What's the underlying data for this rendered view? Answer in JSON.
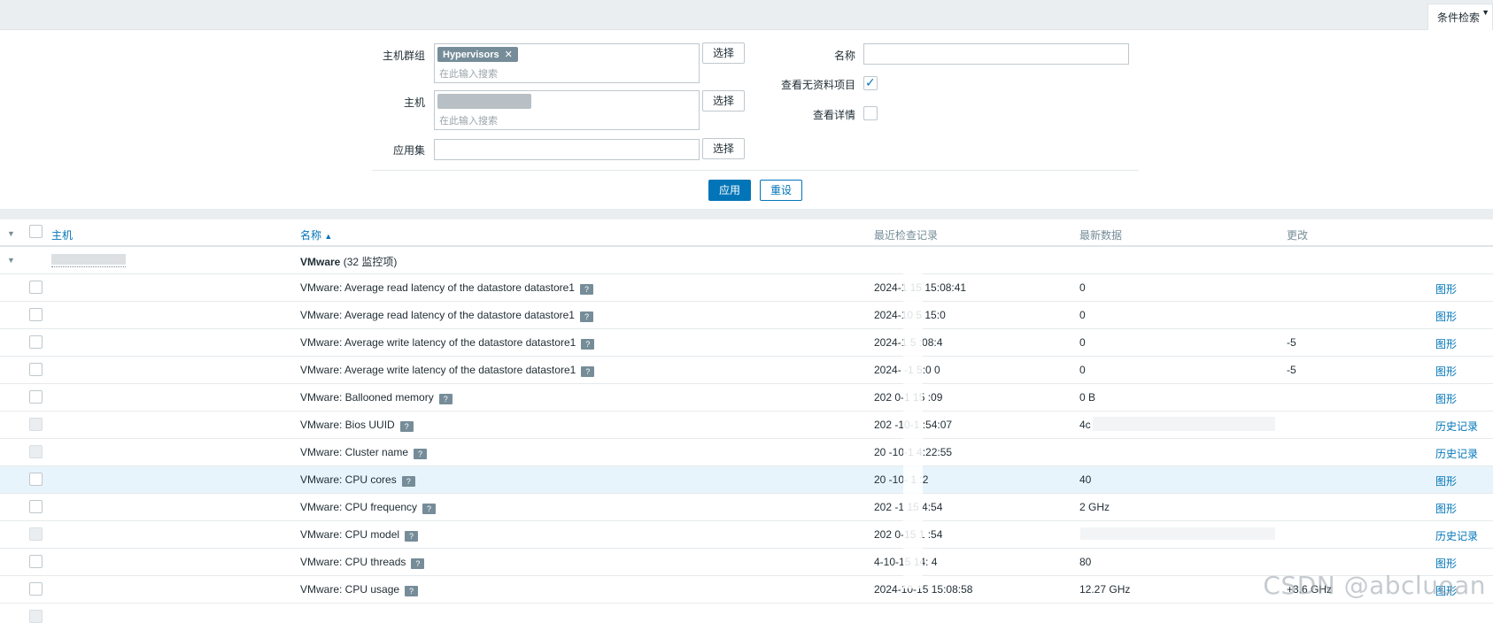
{
  "topbar": {
    "filter_tab": "条件检索"
  },
  "filter": {
    "host_group_label": "主机群组",
    "host_group_tag": "Hypervisors",
    "host_group_placeholder": "在此输入搜索",
    "host_label": "主机",
    "host_placeholder": "在此输入搜索",
    "app_label": "应用集",
    "select_label": "选择",
    "name_label": "名称",
    "show_no_data_label": "查看无资料项目",
    "show_details_label": "查看详情",
    "apply_label": "应用",
    "reset_label": "重设"
  },
  "table": {
    "headers": {
      "host": "主机",
      "name": "名称",
      "last_check": "最近检查记录",
      "last_value": "最新数据",
      "change": "更改"
    },
    "group": {
      "title": "VMware",
      "count": "(32 监控项)"
    },
    "rows": [
      {
        "name": "VMware: Average read latency of the datastore datastore1",
        "time": "2024-1  15 15:08:41",
        "value": "0",
        "change": "",
        "link": "图形"
      },
      {
        "name": "VMware: Average read latency of the datastore datastore1",
        "time": "2024-10  5 15:0",
        "value": "0",
        "change": "",
        "link": "图形"
      },
      {
        "name": "VMware: Average write latency of the datastore datastore1",
        "time": "2024-1  5   :08:4",
        "value": "0",
        "change": "-5",
        "link": "图形"
      },
      {
        "name": "VMware: Average write latency of the datastore datastore1",
        "time": "2024-  -1  5:0  0",
        "value": "0",
        "change": "-5",
        "link": "图形"
      },
      {
        "name": "VMware: Ballooned memory",
        "time": "202  0-1  15   :09",
        "value": "0 B",
        "change": "",
        "link": "图形"
      },
      {
        "name": "VMware: Bios UUID",
        "time": "202  -10-1   :54:07",
        "value": "4c",
        "change": "",
        "link": "历史记录"
      },
      {
        "name": "VMware: Cluster name",
        "time": "20  -10-1   4:22:55",
        "value": "",
        "change": "",
        "link": "历史记录"
      },
      {
        "name": "VMware: CPU cores",
        "time": "20  -10-  1   :2",
        "value": "40",
        "change": "",
        "link": "图形"
      },
      {
        "name": "VMware: CPU frequency",
        "time": "202  -1   15  4:54",
        "value": "2 GHz",
        "change": "",
        "link": "图形"
      },
      {
        "name": "VMware: CPU model",
        "time": "202  0-15 1  :54",
        "value": "",
        "change": "",
        "link": "历史记录"
      },
      {
        "name": "VMware: CPU threads",
        "time": "  4-10-15 14:  4",
        "value": "80",
        "change": "",
        "link": "图形"
      },
      {
        "name": "VMware: CPU usage",
        "time": "2024-10-15 15:08:58",
        "value": "12.27 GHz",
        "change": "+3.6 GHz",
        "link": "图形"
      }
    ]
  },
  "watermark": "CSDN @abcluoan"
}
